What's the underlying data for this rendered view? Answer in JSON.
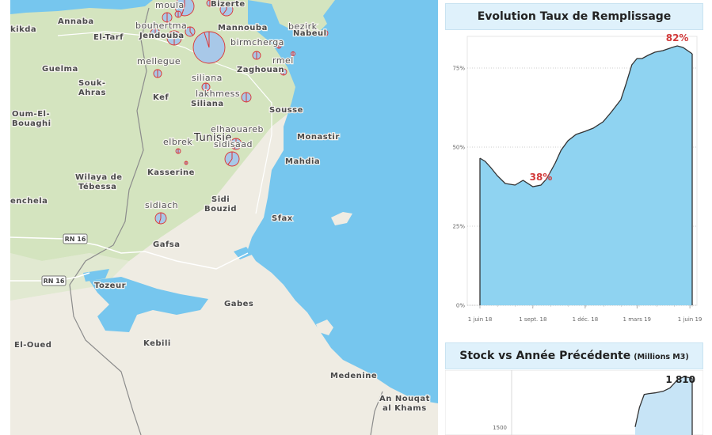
{
  "map": {
    "places": [
      {
        "id": "moula",
        "text": "moula",
        "cls": "small"
      },
      {
        "id": "bizerte",
        "text": "Bizerte",
        "cls": ""
      },
      {
        "id": "annaba",
        "text": "Annaba",
        "cls": ""
      },
      {
        "id": "skikda",
        "text": "kikda",
        "cls": ""
      },
      {
        "id": "eltarf",
        "text": "El-Tarf",
        "cls": ""
      },
      {
        "id": "bouhertma",
        "text": "bouhertma",
        "cls": "small"
      },
      {
        "id": "jendouba",
        "text": "Jendouba",
        "cls": ""
      },
      {
        "id": "mannouba",
        "text": "Mannouba",
        "cls": ""
      },
      {
        "id": "bezirk",
        "text": "bezirk",
        "cls": "small"
      },
      {
        "id": "nabeul",
        "text": "Nabeul",
        "cls": ""
      },
      {
        "id": "birmcherga",
        "text": "birmcherga",
        "cls": "small"
      },
      {
        "id": "guelma",
        "text": "Guelma",
        "cls": ""
      },
      {
        "id": "mellegue",
        "text": "mellegue",
        "cls": "small"
      },
      {
        "id": "rmel",
        "text": "rmel",
        "cls": "small"
      },
      {
        "id": "zaghouan",
        "text": "Zaghouan",
        "cls": ""
      },
      {
        "id": "soukahras1",
        "text": "Souk-",
        "cls": ""
      },
      {
        "id": "soukahras2",
        "text": "Ahras",
        "cls": ""
      },
      {
        "id": "siliana_d",
        "text": "siliana",
        "cls": "small"
      },
      {
        "id": "kef",
        "text": "Kef",
        "cls": ""
      },
      {
        "id": "lakhmess",
        "text": "lakhmess",
        "cls": "small"
      },
      {
        "id": "siliana",
        "text": "Siliana",
        "cls": ""
      },
      {
        "id": "sousse",
        "text": "Sousse",
        "cls": ""
      },
      {
        "id": "oumelbouaghi1",
        "text": "Oum-El-",
        "cls": ""
      },
      {
        "id": "oumelbouaghi2",
        "text": "Bouaghi",
        "cls": ""
      },
      {
        "id": "elhaouareb",
        "text": "elhaouareb",
        "cls": "small"
      },
      {
        "id": "tunisie",
        "text": "Tunisie",
        "cls": "big"
      },
      {
        "id": "monastir",
        "text": "Monastir",
        "cls": ""
      },
      {
        "id": "elbrek",
        "text": "elbrek",
        "cls": "small"
      },
      {
        "id": "sidisaad",
        "text": "sidisaad",
        "cls": "small"
      },
      {
        "id": "mahdia",
        "text": "Mahdia",
        "cls": ""
      },
      {
        "id": "kasserine",
        "text": "Kasserine",
        "cls": ""
      },
      {
        "id": "tebessa1",
        "text": "Wilaya de",
        "cls": ""
      },
      {
        "id": "tebessa2",
        "text": "Tébessa",
        "cls": ""
      },
      {
        "id": "khenchela",
        "text": "enchela",
        "cls": ""
      },
      {
        "id": "sidibouzid1",
        "text": "Sidi",
        "cls": ""
      },
      {
        "id": "sidibouzid2",
        "text": "Bouzid",
        "cls": ""
      },
      {
        "id": "sidiach",
        "text": "sidiach",
        "cls": "small"
      },
      {
        "id": "sfax",
        "text": "Sfax",
        "cls": ""
      },
      {
        "id": "gafsa",
        "text": "Gafsa",
        "cls": ""
      },
      {
        "id": "tozeur",
        "text": "Tozeur",
        "cls": ""
      },
      {
        "id": "gabes",
        "text": "Gabes",
        "cls": ""
      },
      {
        "id": "eloued",
        "text": "El-Oued",
        "cls": ""
      },
      {
        "id": "kebili",
        "text": "Kebili",
        "cls": ""
      },
      {
        "id": "medenine",
        "text": "Medenine",
        "cls": ""
      },
      {
        "id": "annouqat1",
        "text": "An Nouqat",
        "cls": ""
      },
      {
        "id": "annouqat2",
        "text": "al Khams",
        "cls": ""
      }
    ],
    "roads": [
      {
        "id": "rn16a",
        "text": "RN 16"
      },
      {
        "id": "rn16b",
        "text": "RN 16"
      }
    ],
    "dams": [
      {
        "x": 220,
        "y": 8,
        "r": 12,
        "fill": 0.55
      },
      {
        "x": 273,
        "y": 12,
        "r": 8,
        "fill": 0.6
      },
      {
        "x": 252,
        "y": 4,
        "r": 4,
        "fill": 0.5
      },
      {
        "x": 198,
        "y": 22,
        "r": 6,
        "fill": 0.5
      },
      {
        "x": 212,
        "y": 18,
        "r": 4,
        "fill": 0.5
      },
      {
        "x": 183,
        "y": 42,
        "r": 6,
        "fill": 0.45
      },
      {
        "x": 207,
        "y": 48,
        "r": 9,
        "fill": 0.5
      },
      {
        "x": 227,
        "y": 40,
        "r": 6,
        "fill": 0.4
      },
      {
        "x": 251,
        "y": 60,
        "r": 20,
        "fill": 0.95
      },
      {
        "x": 311,
        "y": 70,
        "r": 5,
        "fill": 0.5
      },
      {
        "x": 339,
        "y": 58,
        "r": 3,
        "fill": 0.5
      },
      {
        "x": 397,
        "y": 42,
        "r": 4,
        "fill": 0.5
      },
      {
        "x": 357,
        "y": 68,
        "r": 2.5,
        "fill": 0.5
      },
      {
        "x": 345,
        "y": 91,
        "r": 4,
        "fill": 0.5
      },
      {
        "x": 186,
        "y": 93,
        "r": 5,
        "fill": 0.5
      },
      {
        "x": 247,
        "y": 110,
        "r": 5,
        "fill": 0.5
      },
      {
        "x": 298,
        "y": 123,
        "r": 6,
        "fill": 0.5
      },
      {
        "x": 285,
        "y": 182,
        "r": 7,
        "fill": 0.55
      },
      {
        "x": 212,
        "y": 191,
        "r": 3,
        "fill": 0.5
      },
      {
        "x": 280,
        "y": 201,
        "r": 9,
        "fill": 0.6
      },
      {
        "x": 222,
        "y": 206,
        "r": 2,
        "fill": 0.5
      },
      {
        "x": 190,
        "y": 276,
        "r": 7,
        "fill": 0.55
      }
    ]
  },
  "panel1": {
    "title": "Evolution Taux de Remplissage"
  },
  "panel2": {
    "title": "Stock vs Année Précédente",
    "unit": "(Millions M3)"
  },
  "chart_data": [
    {
      "type": "area",
      "title": "Evolution Taux de Remplissage",
      "x_ticks": [
        "1 juin 18",
        "1 sept. 18",
        "1 déc. 18",
        "1 mars 19",
        "1 juin 19"
      ],
      "y_ticks": [
        "0%",
        "25%",
        "50%",
        "75%"
      ],
      "ylim": [
        0,
        85
      ],
      "grid": true,
      "annotations": [
        {
          "text": "38%",
          "at": "2018-09-15",
          "value": 38
        },
        {
          "text": "82%",
          "at": "2019-05-10",
          "value": 82
        }
      ],
      "x": [
        "2018-06-01",
        "2018-06-10",
        "2018-06-20",
        "2018-07-01",
        "2018-07-15",
        "2018-08-01",
        "2018-08-15",
        "2018-09-01",
        "2018-09-15",
        "2018-09-25",
        "2018-10-01",
        "2018-10-10",
        "2018-10-20",
        "2018-11-01",
        "2018-11-15",
        "2018-12-01",
        "2018-12-15",
        "2019-01-01",
        "2019-01-15",
        "2019-02-01",
        "2019-02-10",
        "2019-02-20",
        "2019-03-01",
        "2019-03-10",
        "2019-03-20",
        "2019-04-01",
        "2019-04-15",
        "2019-05-01",
        "2019-05-10",
        "2019-05-20",
        "2019-06-01",
        "2019-06-05"
      ],
      "values": [
        46.5,
        45.5,
        43.5,
        41,
        38.5,
        38,
        39.5,
        37.5,
        38,
        40,
        42,
        45,
        49,
        52,
        54,
        55,
        56,
        58,
        61,
        65,
        70,
        76,
        78,
        78,
        79,
        80,
        80.5,
        81.5,
        82,
        81.5,
        80,
        79.5
      ]
    },
    {
      "type": "area",
      "title": "Stock vs Année Précédente (Millions M3)",
      "y_ticks": [
        "1500"
      ],
      "annotations": [
        {
          "text": "1 810",
          "value": 1810
        }
      ],
      "x": [
        "2019-02-01",
        "2019-02-10",
        "2019-02-20",
        "2019-03-01",
        "2019-03-15",
        "2019-04-01",
        "2019-04-15",
        "2019-05-01",
        "2019-05-15",
        "2019-06-01"
      ],
      "values": [
        1500,
        1620,
        1700,
        1705,
        1710,
        1720,
        1740,
        1790,
        1810,
        1800
      ]
    }
  ]
}
